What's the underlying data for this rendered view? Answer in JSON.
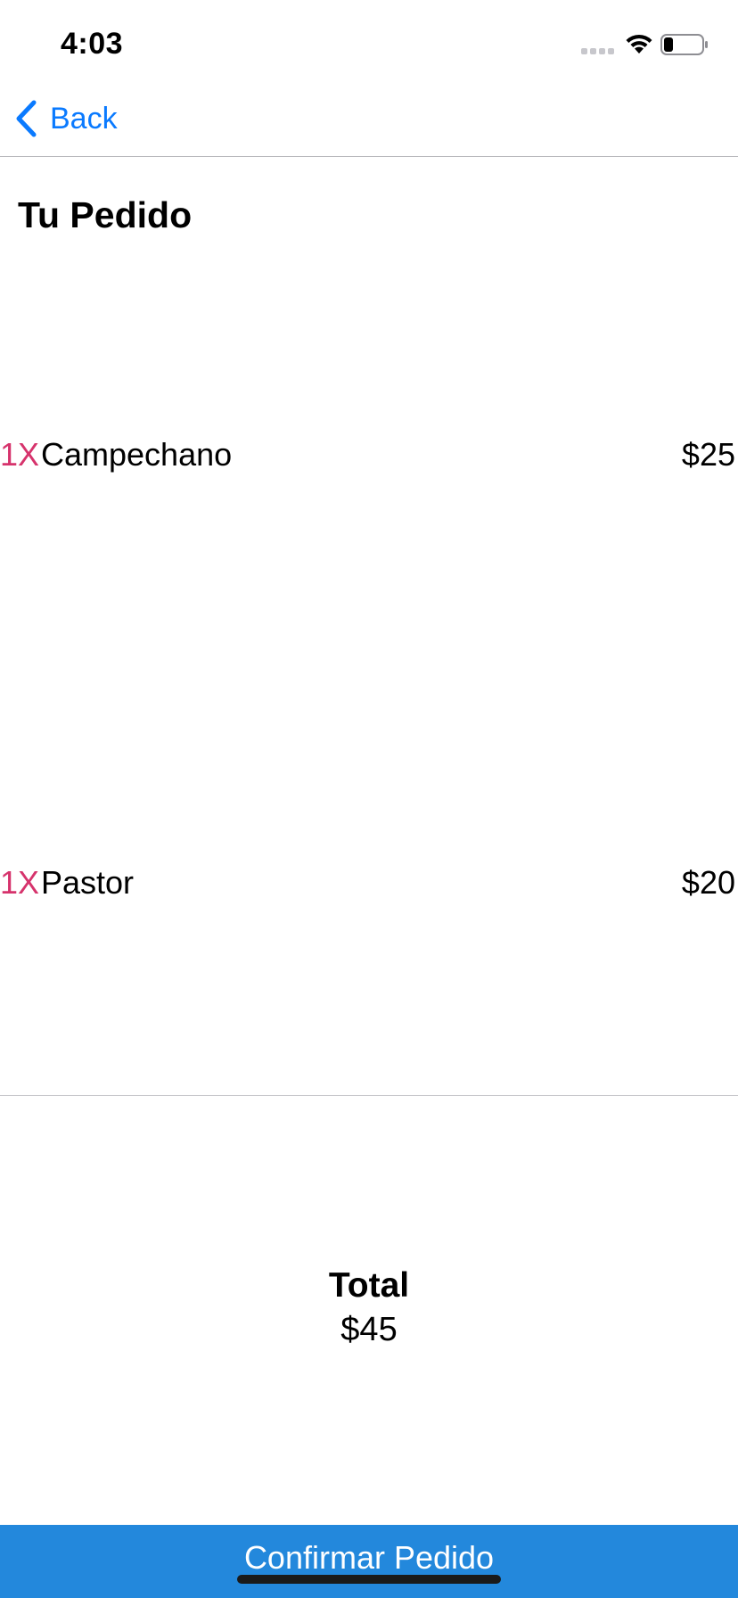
{
  "status_bar": {
    "time": "4:03",
    "icons": [
      "signal-icon",
      "wifi-icon",
      "battery-icon"
    ],
    "battery_level": 0.25
  },
  "nav": {
    "back_label": "Back",
    "back_icon": "chevron-left-icon"
  },
  "page": {
    "title": "Tu Pedido"
  },
  "order": {
    "items": [
      {
        "qty": "1X",
        "name": "Campechano",
        "price": "$25"
      },
      {
        "qty": "1X",
        "name": "Pastor",
        "price": "$20"
      }
    ]
  },
  "summary": {
    "total_label": "Total",
    "total_value": "$45"
  },
  "footer": {
    "confirm_label": "Confirmar Pedido"
  },
  "colors": {
    "accent_blue": "#0a7aff",
    "button_blue": "#2388dc",
    "quantity_pink": "#d6336c"
  }
}
